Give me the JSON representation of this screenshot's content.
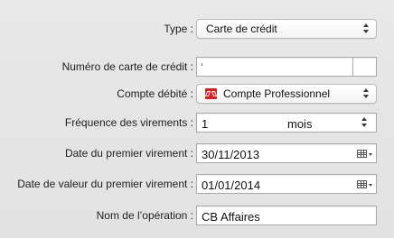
{
  "form": {
    "type_label": "Type :",
    "type_value": "Carte de crédit",
    "card_number_label": "Numéro de carte de crédit :",
    "debited_account_label": "Compte débité :",
    "debited_account_value": "Compte Professionnel",
    "transfer_frequency_label": "Fréquence des virements :",
    "transfer_frequency_value": "1",
    "transfer_frequency_unit": "mois",
    "first_transfer_date_label": "Date du premier virement :",
    "first_transfer_date_value": "30/11/2013",
    "first_value_date_label": "Date de valeur du premier virement :",
    "first_value_date_value": "01/01/2014",
    "operation_name_label": "Nom de l’opération :",
    "operation_name_value": "CB Affaires"
  },
  "icons": {
    "select_arrows": "up-down-arrows-icon",
    "bank": "bank-logo-icon",
    "calendar": "calendar-icon"
  },
  "colors": {
    "window_background": "#e6e6e6",
    "bank_logo": "#d71d1d"
  }
}
